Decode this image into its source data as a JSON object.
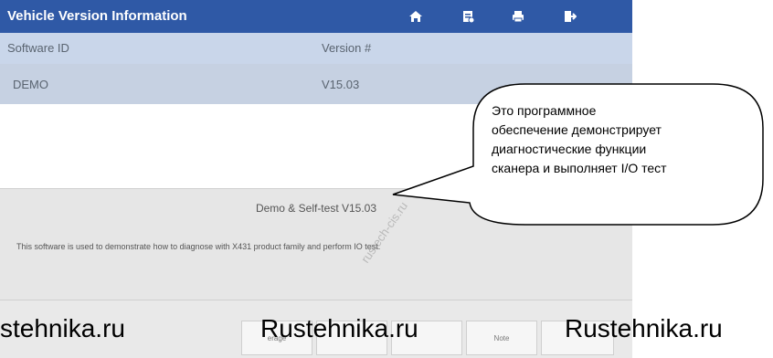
{
  "header": {
    "title": "Vehicle Version Information",
    "icons": [
      "home-icon",
      "report-icon",
      "print-icon",
      "exit-icon"
    ]
  },
  "table": {
    "columns": [
      "Software ID",
      "Version #"
    ],
    "rows": [
      [
        "DEMO",
        "V15.03"
      ]
    ]
  },
  "description": {
    "title": "Demo & Self-test V15.03",
    "text": "This software is used to demonstrate how to diagnose with X431 product family and perform IO test."
  },
  "callout": {
    "lines": [
      "Это программное",
      "обеспечение демонстрирует",
      "диагностические функции",
      "сканера и выполняет I/O тест"
    ]
  },
  "bottom_bar": {
    "buttons": [
      "erage",
      "",
      "",
      "Note",
      ""
    ]
  },
  "watermarks": {
    "left": "stehnika.ru",
    "middle": "Rustehnika.ru",
    "right": "Rustehnika.ru",
    "diagonal": "rustech-cis.ru"
  },
  "colors": {
    "titlebar": "#2f59a6",
    "table_header": "#c9d6ea",
    "selected_row": "#c6d1e2",
    "description_bg": "#e6e6e6"
  }
}
